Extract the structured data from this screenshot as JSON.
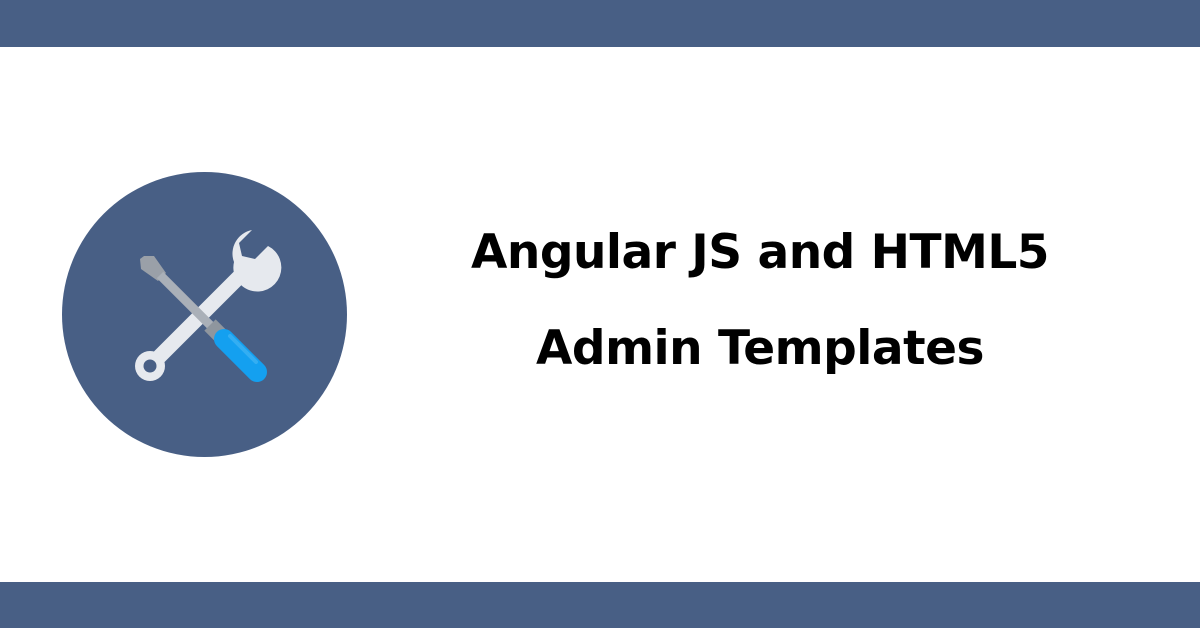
{
  "banner": {
    "title_line_1": "Angular JS and HTML5",
    "title_line_2": "Admin Templates"
  },
  "badge": {
    "icon": "tools-icon",
    "wrench_icon": "wrench-icon",
    "screwdriver_icon": "screwdriver-icon"
  },
  "colors": {
    "band": "#485f85",
    "badge_circle": "#485f85",
    "wrench": "#e6e9ee",
    "screwdriver_shaft": "#aab0b8",
    "screwdriver_tip": "#9aa0a8",
    "screwdriver_handle": "#14a0f0",
    "text": "#000000",
    "background": "#ffffff"
  }
}
